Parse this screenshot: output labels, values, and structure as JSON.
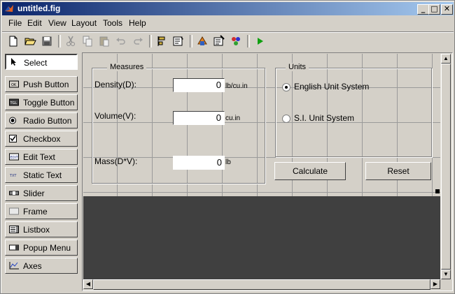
{
  "window": {
    "title": "untitled.fig",
    "controls": {
      "minimize": "_",
      "maximize": "□",
      "close": "✕"
    }
  },
  "menubar": {
    "items": [
      "File",
      "Edit",
      "View",
      "Layout",
      "Tools",
      "Help"
    ]
  },
  "toolbar": {
    "icons": [
      "new-file-icon",
      "open-folder-icon",
      "save-icon",
      "cut-icon",
      "copy-icon",
      "paste-icon",
      "undo-icon",
      "redo-icon",
      "align-icon",
      "tab-order-icon",
      "menu-editor-icon",
      "property-inspector-icon",
      "object-browser-icon",
      "run-icon"
    ]
  },
  "palette": {
    "items": [
      {
        "label": "Select",
        "icon": "pointer-icon",
        "selected": true
      },
      {
        "label": "Push Button",
        "icon": "push-button-icon"
      },
      {
        "label": "Toggle Button",
        "icon": "toggle-button-icon"
      },
      {
        "label": "Radio Button",
        "icon": "radio-button-icon"
      },
      {
        "label": "Checkbox",
        "icon": "checkbox-icon"
      },
      {
        "label": "Edit Text",
        "icon": "edit-text-icon"
      },
      {
        "label": "Static Text",
        "icon": "static-text-icon"
      },
      {
        "label": "Slider",
        "icon": "slider-icon"
      },
      {
        "label": "Frame",
        "icon": "frame-icon"
      },
      {
        "label": "Listbox",
        "icon": "listbox-icon"
      },
      {
        "label": "Popup Menu",
        "icon": "popup-menu-icon"
      },
      {
        "label": "Axes",
        "icon": "axes-icon"
      }
    ]
  },
  "measures": {
    "title": "Measures",
    "density": {
      "label": "Density(D):",
      "value": "0",
      "unit": "lb/cu.in"
    },
    "volume": {
      "label": "Volume(V):",
      "value": "0",
      "unit": "cu.in"
    },
    "mass": {
      "label": "Mass(D*V):",
      "value": "0",
      "unit": "lb"
    }
  },
  "units": {
    "title": "Units",
    "english": {
      "label": "English Unit System",
      "checked": true
    },
    "si": {
      "label": "S.I. Unit System",
      "checked": false
    }
  },
  "buttons": {
    "calculate": "Calculate",
    "reset": "Reset"
  },
  "colors": {
    "face": "#d4d0c8",
    "dark_area": "#404040",
    "title_start": "#0a246a",
    "title_end": "#a6caf0"
  }
}
